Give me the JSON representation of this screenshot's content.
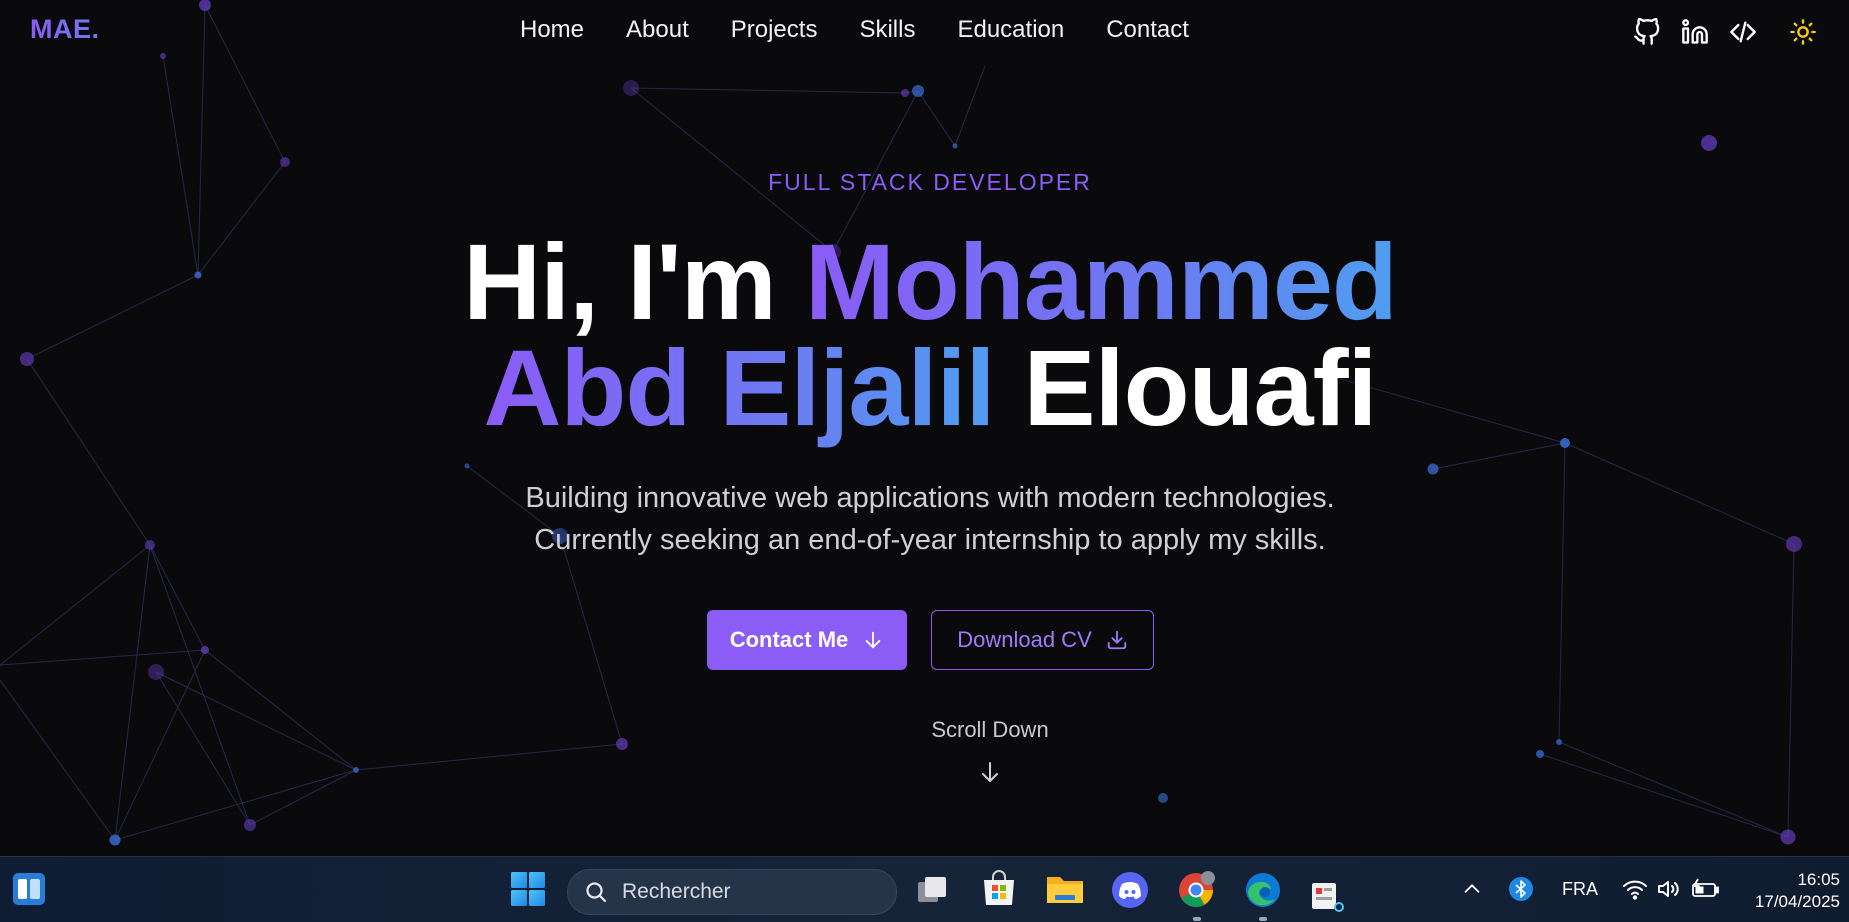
{
  "navbar": {
    "logo": "MAE.",
    "links": [
      "Home",
      "About",
      "Projects",
      "Skills",
      "Education",
      "Contact"
    ],
    "icons": [
      "github-icon",
      "linkedin-icon",
      "code-icon",
      "sun-icon"
    ]
  },
  "hero": {
    "subtitle": "FULL STACK DEVELOPER",
    "greeting": "Hi, I'm",
    "name_first": "Mohammed",
    "name_middle": "Abd Eljalil",
    "name_last": "Elouafi",
    "description_line1": "Building innovative web applications with modern technologies.",
    "description_line2": "Currently seeking an end-of-year internship to apply my skills.",
    "contact_button": "Contact Me",
    "cv_button": "Download CV",
    "scroll_label": "Scroll Down"
  },
  "taskbar": {
    "search_placeholder": "Rechercher",
    "apps": [
      "widgets-icon",
      "windows-start-icon",
      "task-view-icon",
      "microsoft-store-icon",
      "file-explorer-icon",
      "discord-icon",
      "chrome-icon",
      "edge-icon",
      "snipping-tool-icon"
    ],
    "language": "FRA",
    "time": "16:05",
    "date": "17/04/2025"
  },
  "colors": {
    "accent": "#8b5cf6",
    "accent_blue": "#4f9ef0",
    "background": "#0a0a0d",
    "taskbar": "#13213a"
  }
}
